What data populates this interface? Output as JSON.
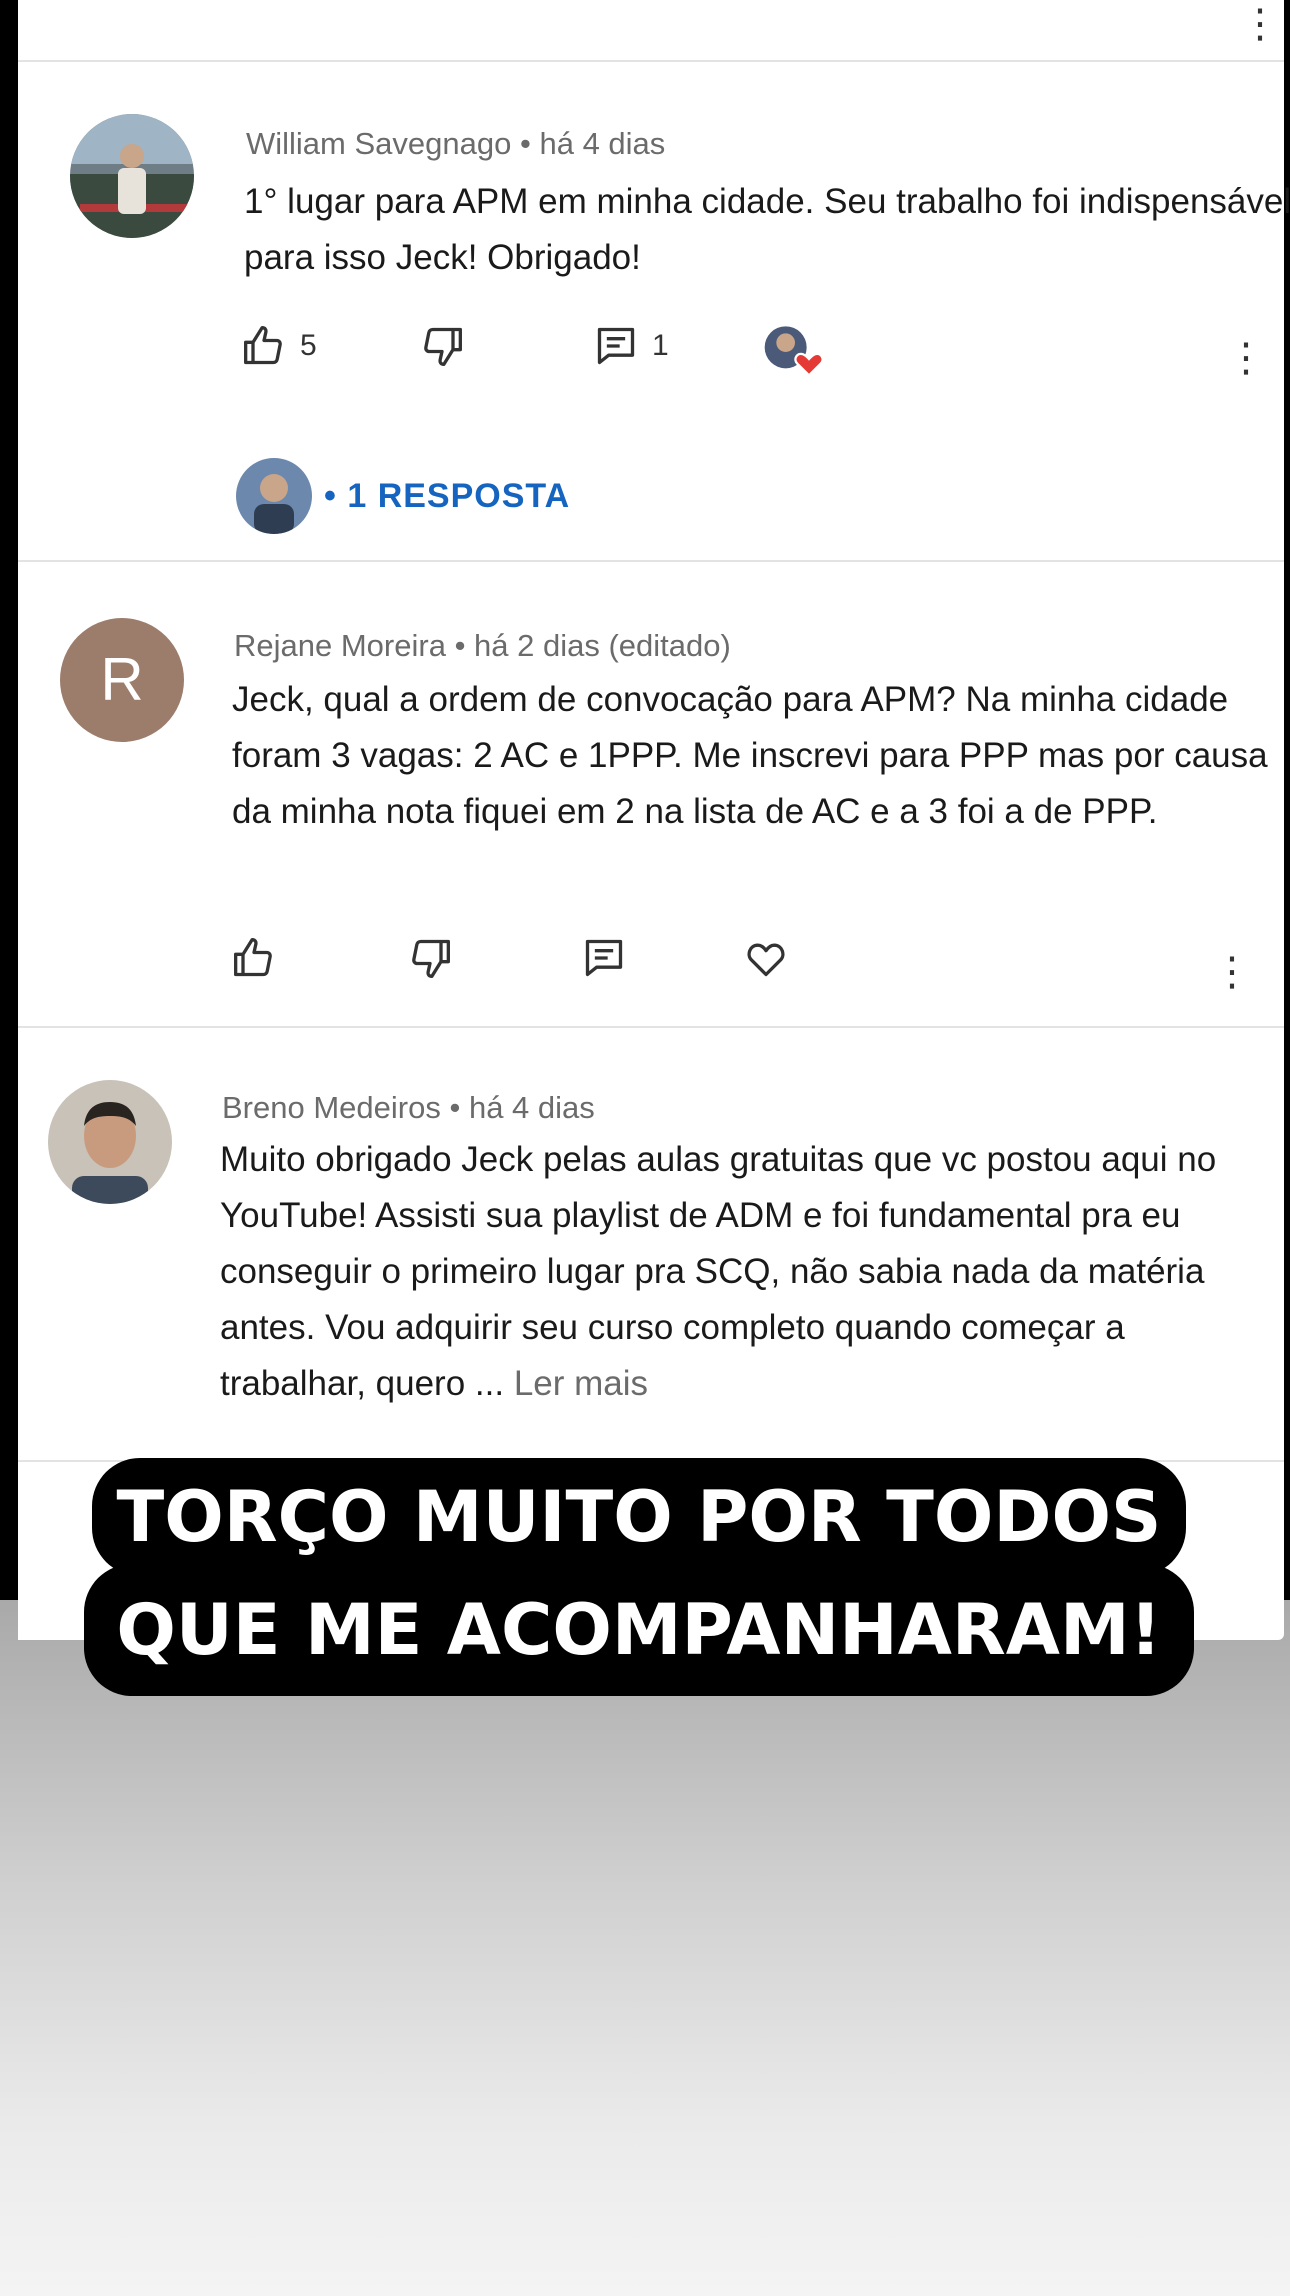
{
  "comments": [
    {
      "author": "William Savegnago",
      "time": "há 4 dias",
      "text": "1° lugar para APM em minha cidade. Seu trabalho foi indispensável para isso Jeck! Obrigado!",
      "likes": "5",
      "replies_count": "1",
      "reply_link": "• 1 RESPOSTA",
      "icons": [
        "thumb-up-icon",
        "thumb-down-icon",
        "reply-icon",
        "creator-heart-icon",
        "more-vert-icon"
      ]
    },
    {
      "author": "Rejane Moreira",
      "time": "há 2 dias (editado)",
      "avatar_letter": "R",
      "text": "Jeck, qual a ordem de convocação para APM? Na minha cidade foram 3 vagas: 2 AC e 1PPP. Me inscrevi para PPP mas por causa da minha nota fiquei em 2 na lista de AC e a 3 foi a de PPP.",
      "icons": [
        "thumb-up-icon",
        "thumb-down-icon",
        "reply-icon",
        "heart-outline-icon",
        "more-vert-icon"
      ]
    },
    {
      "author": "Breno Medeiros",
      "time": "há 4 dias",
      "text": "Muito obrigado Jeck pelas aulas gratuitas que vc postou aqui no YouTube! Assisti sua playlist de ADM e foi fundamental pra eu conseguir o primeiro lugar pra SCQ, não sabia nada da matéria antes. Vou adquirir seu curso completo quando começar a trabalhar, quero ...",
      "read_more": "Ler mais"
    }
  ],
  "separator": "•",
  "banner": {
    "line1": "TORÇO MUITO POR TODOS",
    "line2": "QUE ME ACOMPANHARAM!"
  },
  "colors": {
    "link": "#1565c0",
    "heart": "#e53935",
    "avatar_letter_bg": "#9c7d6c"
  }
}
